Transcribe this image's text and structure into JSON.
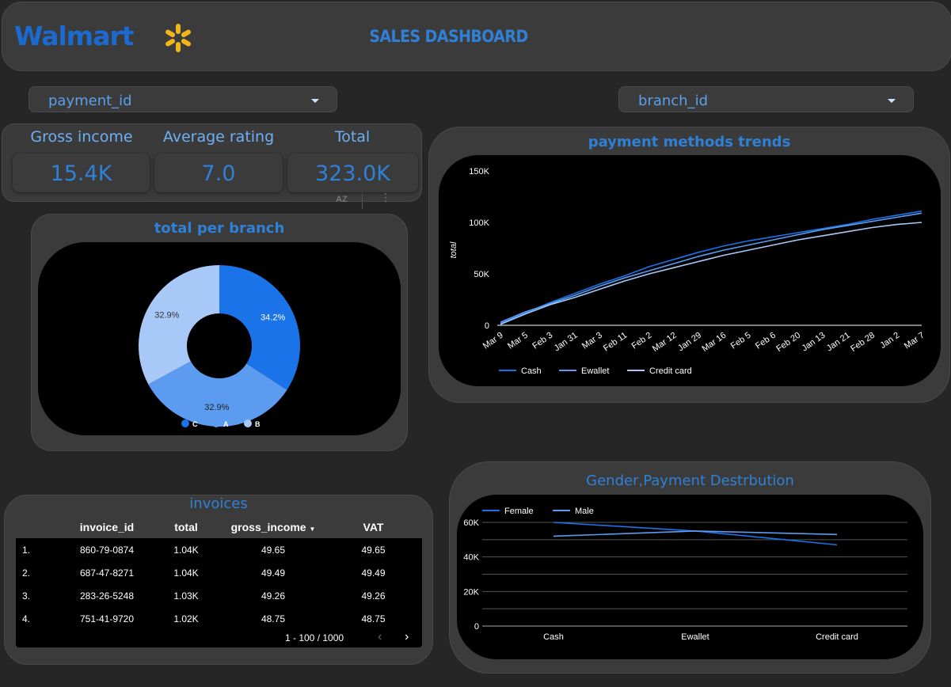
{
  "header": {
    "logo": "Walmart",
    "title": "SALES DASHBOARD"
  },
  "filters": {
    "payment": "payment_id",
    "branch": "branch_id"
  },
  "kpis": [
    {
      "label": "Gross income",
      "value": "15.4K"
    },
    {
      "label": "Average rating",
      "value": "7.0"
    },
    {
      "label": "Total",
      "value": "323.0K"
    }
  ],
  "kpi_toolbar": {
    "sort_icon": "AZ"
  },
  "pie": {
    "title": "total per branch"
  },
  "line_chart": {
    "title": "payment methods trends"
  },
  "table": {
    "title": "invoices",
    "headers": [
      "invoice_id",
      "total",
      "gross_income",
      "VAT"
    ],
    "rows": [
      {
        "n": "1.",
        "invoice_id": "860-79-0874",
        "total": "1.04K",
        "gross_income": "49.65",
        "vat": "49.65"
      },
      {
        "n": "2.",
        "invoice_id": "687-47-8271",
        "total": "1.04K",
        "gross_income": "49.49",
        "vat": "49.49"
      },
      {
        "n": "3.",
        "invoice_id": "283-26-5248",
        "total": "1.03K",
        "gross_income": "49.26",
        "vat": "49.26"
      },
      {
        "n": "4.",
        "invoice_id": "751-41-9720",
        "total": "1.02K",
        "gross_income": "48.75",
        "vat": "48.75"
      }
    ],
    "pagination": "1 - 100 / 1000"
  },
  "gender_chart": {
    "title": "Gender,Payment Destrbution"
  },
  "colors": {
    "accent": "#2f80d6",
    "panel": "#3b3b3b",
    "background": "#262626",
    "series_dark": "#1a73e8",
    "series_mid": "#5b9cf0",
    "series_light": "#a8c8f8"
  },
  "chart_data": [
    {
      "type": "pie",
      "title": "total per branch",
      "donut": true,
      "categories": [
        "C",
        "A",
        "B"
      ],
      "values": [
        34.2,
        32.9,
        32.9
      ],
      "value_labels": [
        "34.2%",
        "32.9%",
        "32.9%"
      ],
      "colors": [
        "#1a73e8",
        "#5b9cf0",
        "#a8c8f8"
      ],
      "legend": "bottom"
    },
    {
      "type": "line",
      "title": "payment methods trends",
      "ylabel": "total",
      "ylim": [
        0,
        150000
      ],
      "y_ticks": [
        "0",
        "50K",
        "100K",
        "150K"
      ],
      "x_ticks": [
        "Mar 9",
        "Mar 5",
        "Feb 3",
        "Jan 31",
        "Mar 3",
        "Feb 11",
        "Feb 2",
        "Mar 12",
        "Jan 29",
        "Mar 16",
        "Feb 5",
        "Feb 6",
        "Feb 20",
        "Jan 13",
        "Jan 21",
        "Feb 28",
        "Jan 2",
        "Mar 7"
      ],
      "legend": "bottom",
      "series": [
        {
          "name": "Cash",
          "color": "#1a73e8",
          "values": [
            2000,
            12000,
            22000,
            31000,
            40000,
            48000,
            57000,
            64000,
            71000,
            77000,
            82000,
            86000,
            90000,
            94000,
            98000,
            103000,
            107000,
            111000
          ]
        },
        {
          "name": "Ewallet",
          "color": "#5b9cf0",
          "values": [
            3000,
            13000,
            21000,
            29000,
            38000,
            46000,
            53000,
            60000,
            67000,
            73000,
            78000,
            83000,
            88000,
            93000,
            97000,
            101000,
            105000,
            109000
          ]
        },
        {
          "name": "Credit card",
          "color": "#a8c8f8",
          "values": [
            1000,
            11000,
            20000,
            27000,
            35000,
            43000,
            50000,
            56000,
            62000,
            68000,
            73000,
            78000,
            83000,
            87000,
            91000,
            95000,
            98000,
            100000
          ]
        }
      ]
    },
    {
      "type": "line",
      "title": "Gender,Payment Destrbution",
      "categories": [
        "Cash",
        "Ewallet",
        "Credit card"
      ],
      "ylim": [
        0,
        60000
      ],
      "y_ticks": [
        "0",
        "20K",
        "40K",
        "60K"
      ],
      "legend": "top-left",
      "series": [
        {
          "name": "Female",
          "color": "#1a73e8",
          "values": [
            60000,
            55000,
            47000
          ]
        },
        {
          "name": "Male",
          "color": "#5b9cf0",
          "values": [
            52000,
            55000,
            53000
          ]
        }
      ]
    }
  ]
}
